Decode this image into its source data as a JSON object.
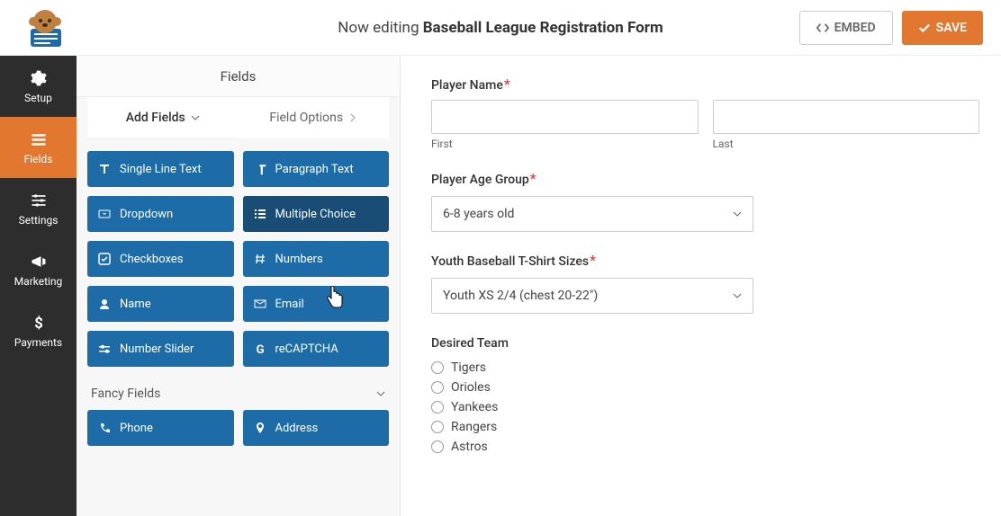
{
  "header": {
    "editing_prefix": "Now editing ",
    "form_title": "Baseball League Registration Form",
    "embed_label": "EMBED",
    "save_label": "SAVE"
  },
  "sidebar": {
    "items": [
      {
        "label": "Setup"
      },
      {
        "label": "Fields"
      },
      {
        "label": "Settings"
      },
      {
        "label": "Marketing"
      },
      {
        "label": "Payments"
      }
    ]
  },
  "panel": {
    "tabs": {
      "add_fields": "Add Fields",
      "field_options": "Field Options"
    },
    "preview_title": "Fields",
    "standard_fields": [
      {
        "label": "Single Line Text",
        "icon": "text"
      },
      {
        "label": "Paragraph Text",
        "icon": "paragraph"
      },
      {
        "label": "Dropdown",
        "icon": "dropdown"
      },
      {
        "label": "Multiple Choice",
        "icon": "list",
        "hover": true
      },
      {
        "label": "Checkboxes",
        "icon": "check"
      },
      {
        "label": "Numbers",
        "icon": "hash"
      },
      {
        "label": "Name",
        "icon": "user"
      },
      {
        "label": "Email",
        "icon": "mail"
      },
      {
        "label": "Number Slider",
        "icon": "slider"
      },
      {
        "label": "reCAPTCHA",
        "icon": "google"
      }
    ],
    "fancy_title": "Fancy Fields",
    "fancy_fields": [
      {
        "label": "Phone",
        "icon": "phone"
      },
      {
        "label": "Address",
        "icon": "pin"
      }
    ]
  },
  "form": {
    "player_name": {
      "label": "Player Name",
      "first": "First",
      "last": "Last"
    },
    "age_group": {
      "label": "Player Age Group",
      "value": "6-8 years old"
    },
    "tshirt": {
      "label": "Youth Baseball T-Shirt Sizes",
      "value": "Youth XS  2/4 (chest 20-22\")"
    },
    "desired_team": {
      "label": "Desired Team",
      "options": [
        "Tigers",
        "Orioles",
        "Yankees",
        "Rangers",
        "Astros"
      ]
    }
  }
}
